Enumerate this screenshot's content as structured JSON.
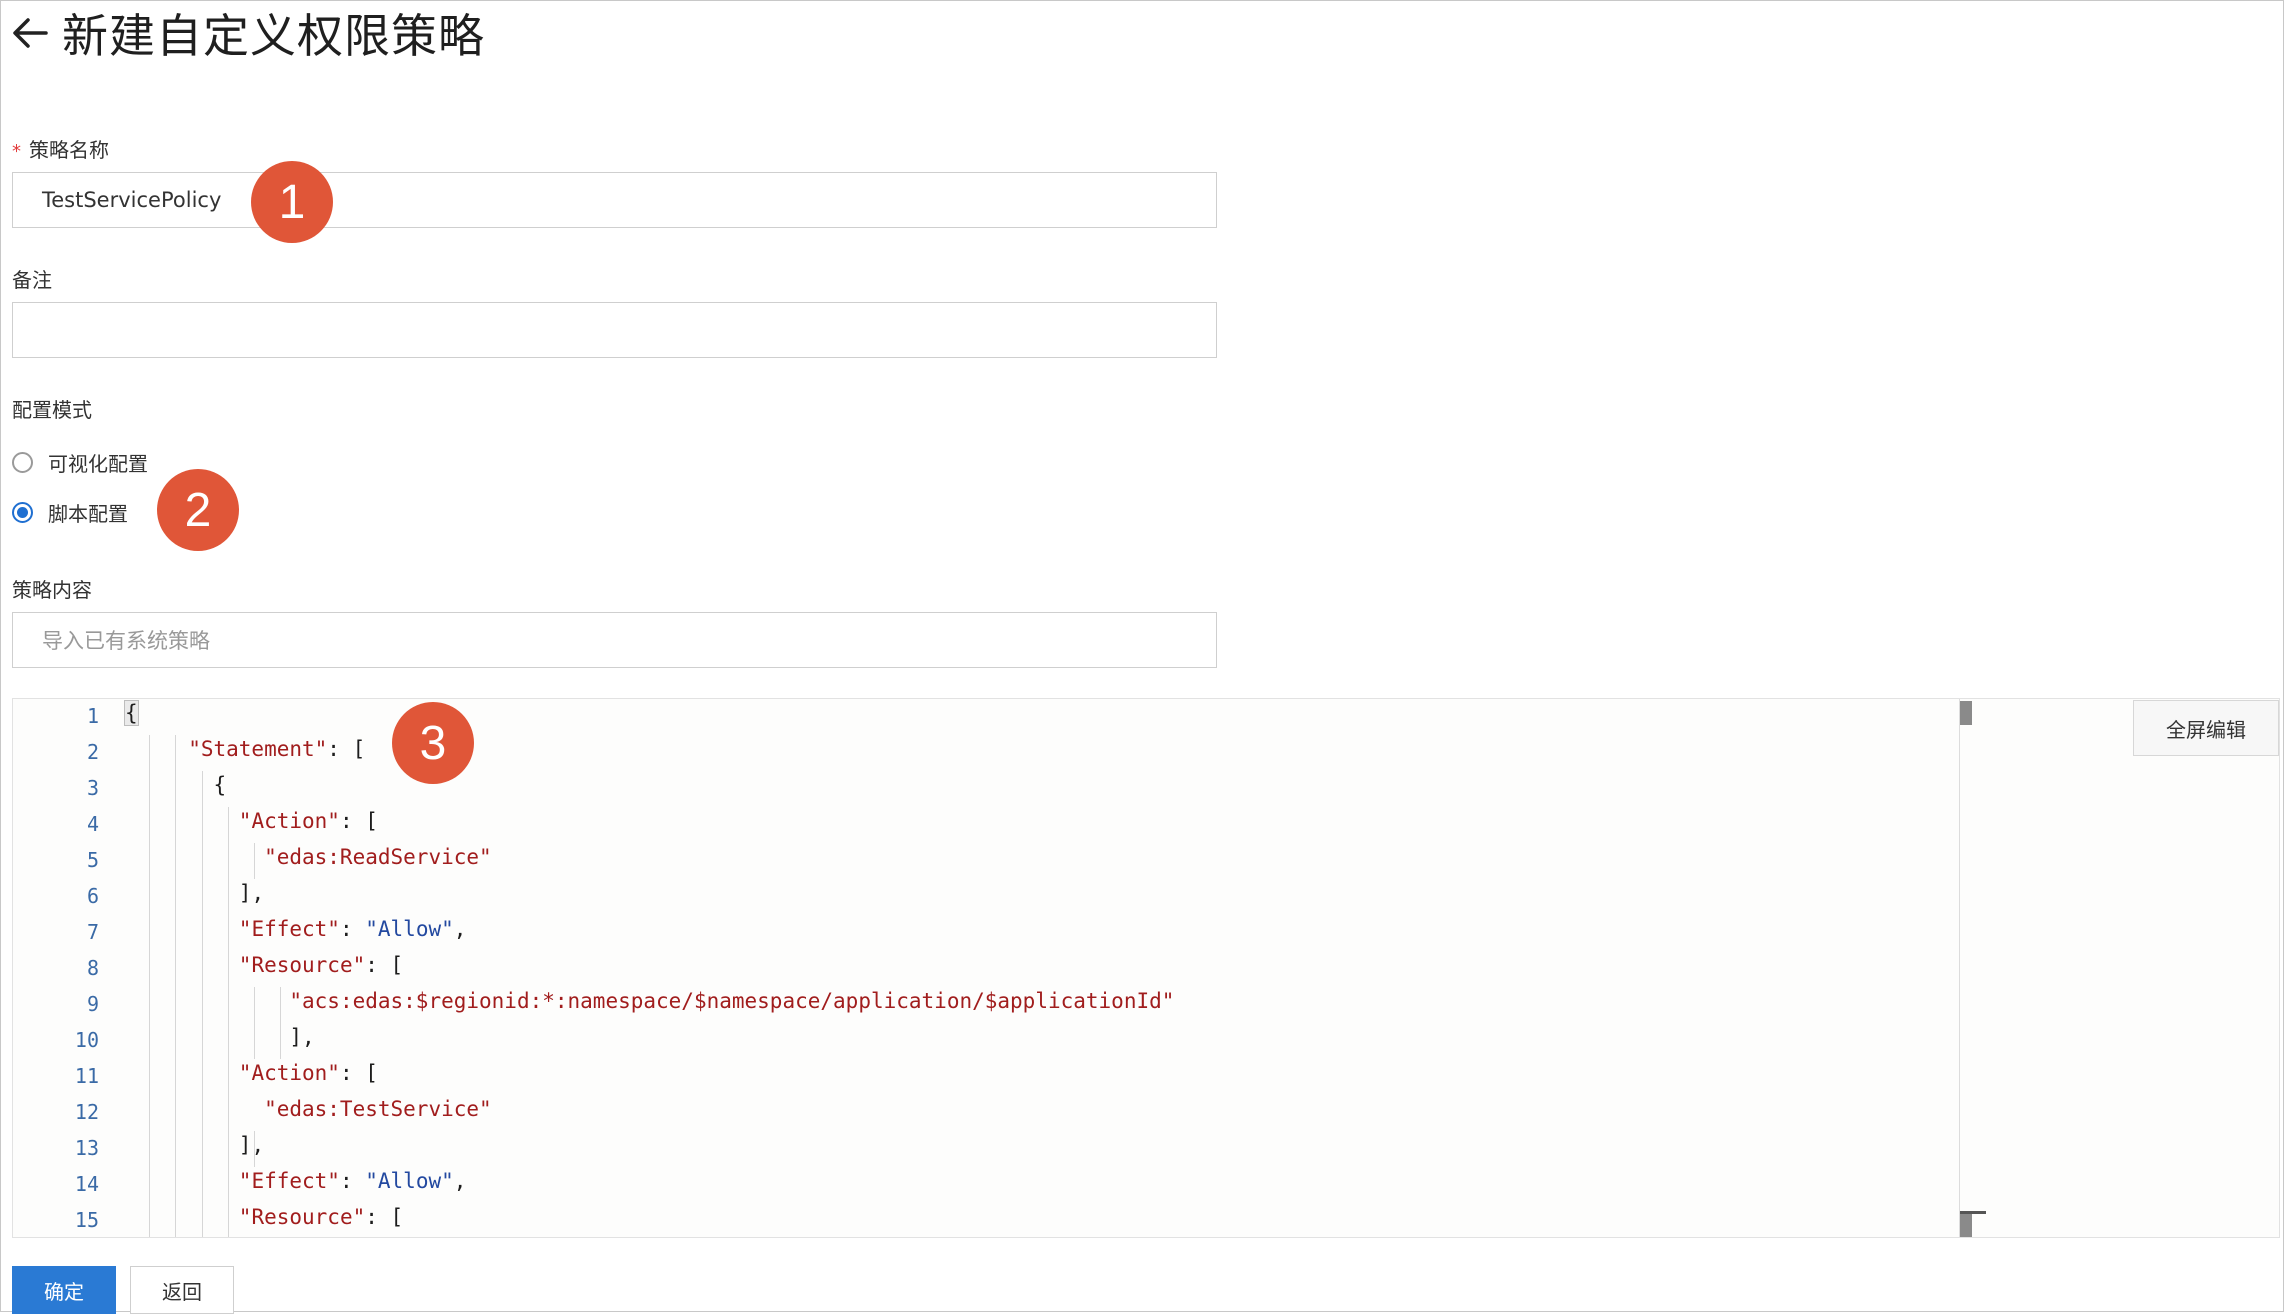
{
  "header": {
    "back_icon": "arrow-left-icon",
    "title": "新建自定义权限策略"
  },
  "form": {
    "policy_name": {
      "label": "策略名称",
      "required_mark": "*",
      "value": "TestServicePolicy"
    },
    "remark": {
      "label": "备注",
      "value": ""
    },
    "config_mode": {
      "label": "配置模式",
      "options": [
        {
          "label": "可视化配置",
          "checked": false
        },
        {
          "label": "脚本配置",
          "checked": true
        }
      ]
    },
    "policy_content": {
      "label": "策略内容",
      "placeholder": "导入已有系统策略"
    }
  },
  "editor": {
    "fullscreen_label": "全屏编辑",
    "line_numbers": [
      "1",
      "2",
      "3",
      "4",
      "5",
      "6",
      "7",
      "8",
      "9",
      "10",
      "11",
      "12",
      "13",
      "14",
      "15"
    ]
  },
  "badges": [
    "1",
    "2",
    "3"
  ],
  "buttons": {
    "confirm": "确定",
    "back": "返回"
  },
  "colors": {
    "primary": "#2a7ad4",
    "badge": "#e05638",
    "json_key": "#a11d1d",
    "json_value": "#2349a0"
  }
}
